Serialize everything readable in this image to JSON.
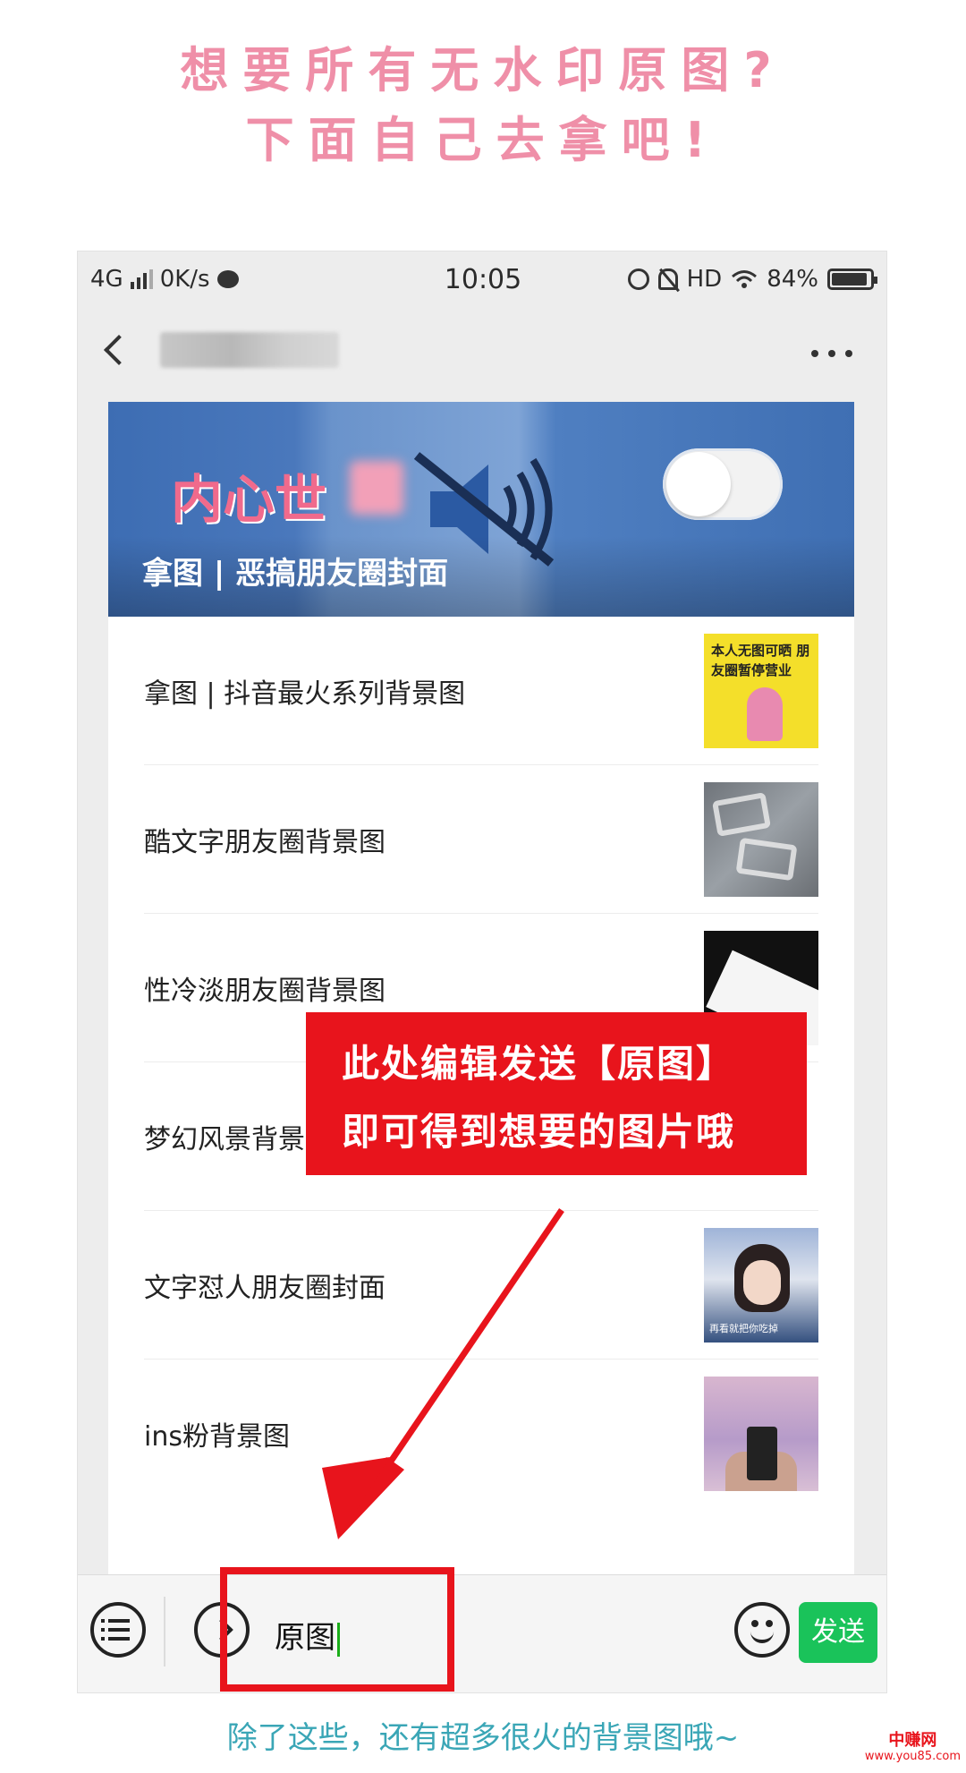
{
  "headline": {
    "line1": "想要所有无水印原图?",
    "line2": "下面自己去拿吧!"
  },
  "statusbar": {
    "network": "4G",
    "speed": "0K/s",
    "time": "10:05",
    "hd": "HD",
    "battery": "84%"
  },
  "banner": {
    "overlay_text": "内心世",
    "title": "拿图 | 恶搞朋友圈封面"
  },
  "articles": [
    {
      "title": "拿图 | 抖音最火系列背景图",
      "thumb_text": "本人无图可晒 朋友圈暂停营业",
      "thumb": "yellow"
    },
    {
      "title": "酷文字朋友圈背景图",
      "thumb": "gray"
    },
    {
      "title": "性冷淡朋友圈背景图",
      "thumb": "dark"
    },
    {
      "title": "梦幻风景背景",
      "thumb": "none"
    },
    {
      "title": "文字怼人朋友圈封面",
      "thumb_text": "再看就把你吃掉",
      "thumb": "photo"
    },
    {
      "title": "ins粉背景图",
      "thumb": "pinksky"
    }
  ],
  "callout": {
    "line1": "此处编辑发送【原图】",
    "line2": "即可得到想要的图片哦"
  },
  "input": {
    "value": "原图",
    "send_label": "发送"
  },
  "footer": {
    "text": "除了这些，还有超多很火的背景图哦~"
  },
  "watermark": {
    "name": "中赚网",
    "url": "www.you85.com"
  },
  "colors": {
    "headline_pink": "#ef8fa8",
    "callout_red": "#e8141c",
    "send_green": "#1ac35a",
    "footer_teal": "#3aa6b6"
  }
}
